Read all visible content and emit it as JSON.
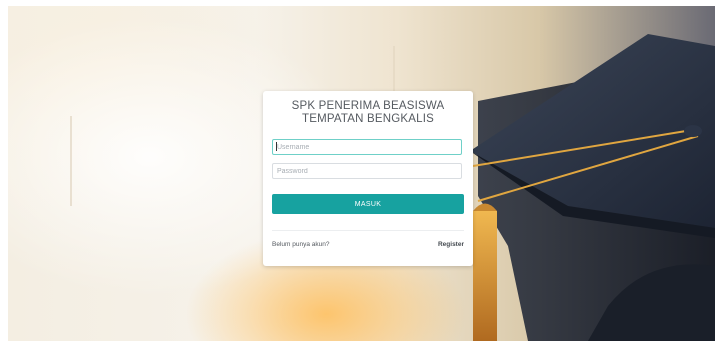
{
  "login": {
    "title_line1": "SPK PENERIMA BEASISWA",
    "title_line2": "TEMPATAN BENGKALIS",
    "username_placeholder": "Username",
    "password_placeholder": "Password",
    "submit_label": "MASUK",
    "no_account_text": "Belum punya akun?",
    "register_label": "Register"
  },
  "colors": {
    "accent": "#17a2a0",
    "focus_border": "#6fd0c8",
    "cap": "#2b3446",
    "tassel": "#e0a640"
  },
  "icons": {
    "background": "graduation-cap-photo"
  }
}
